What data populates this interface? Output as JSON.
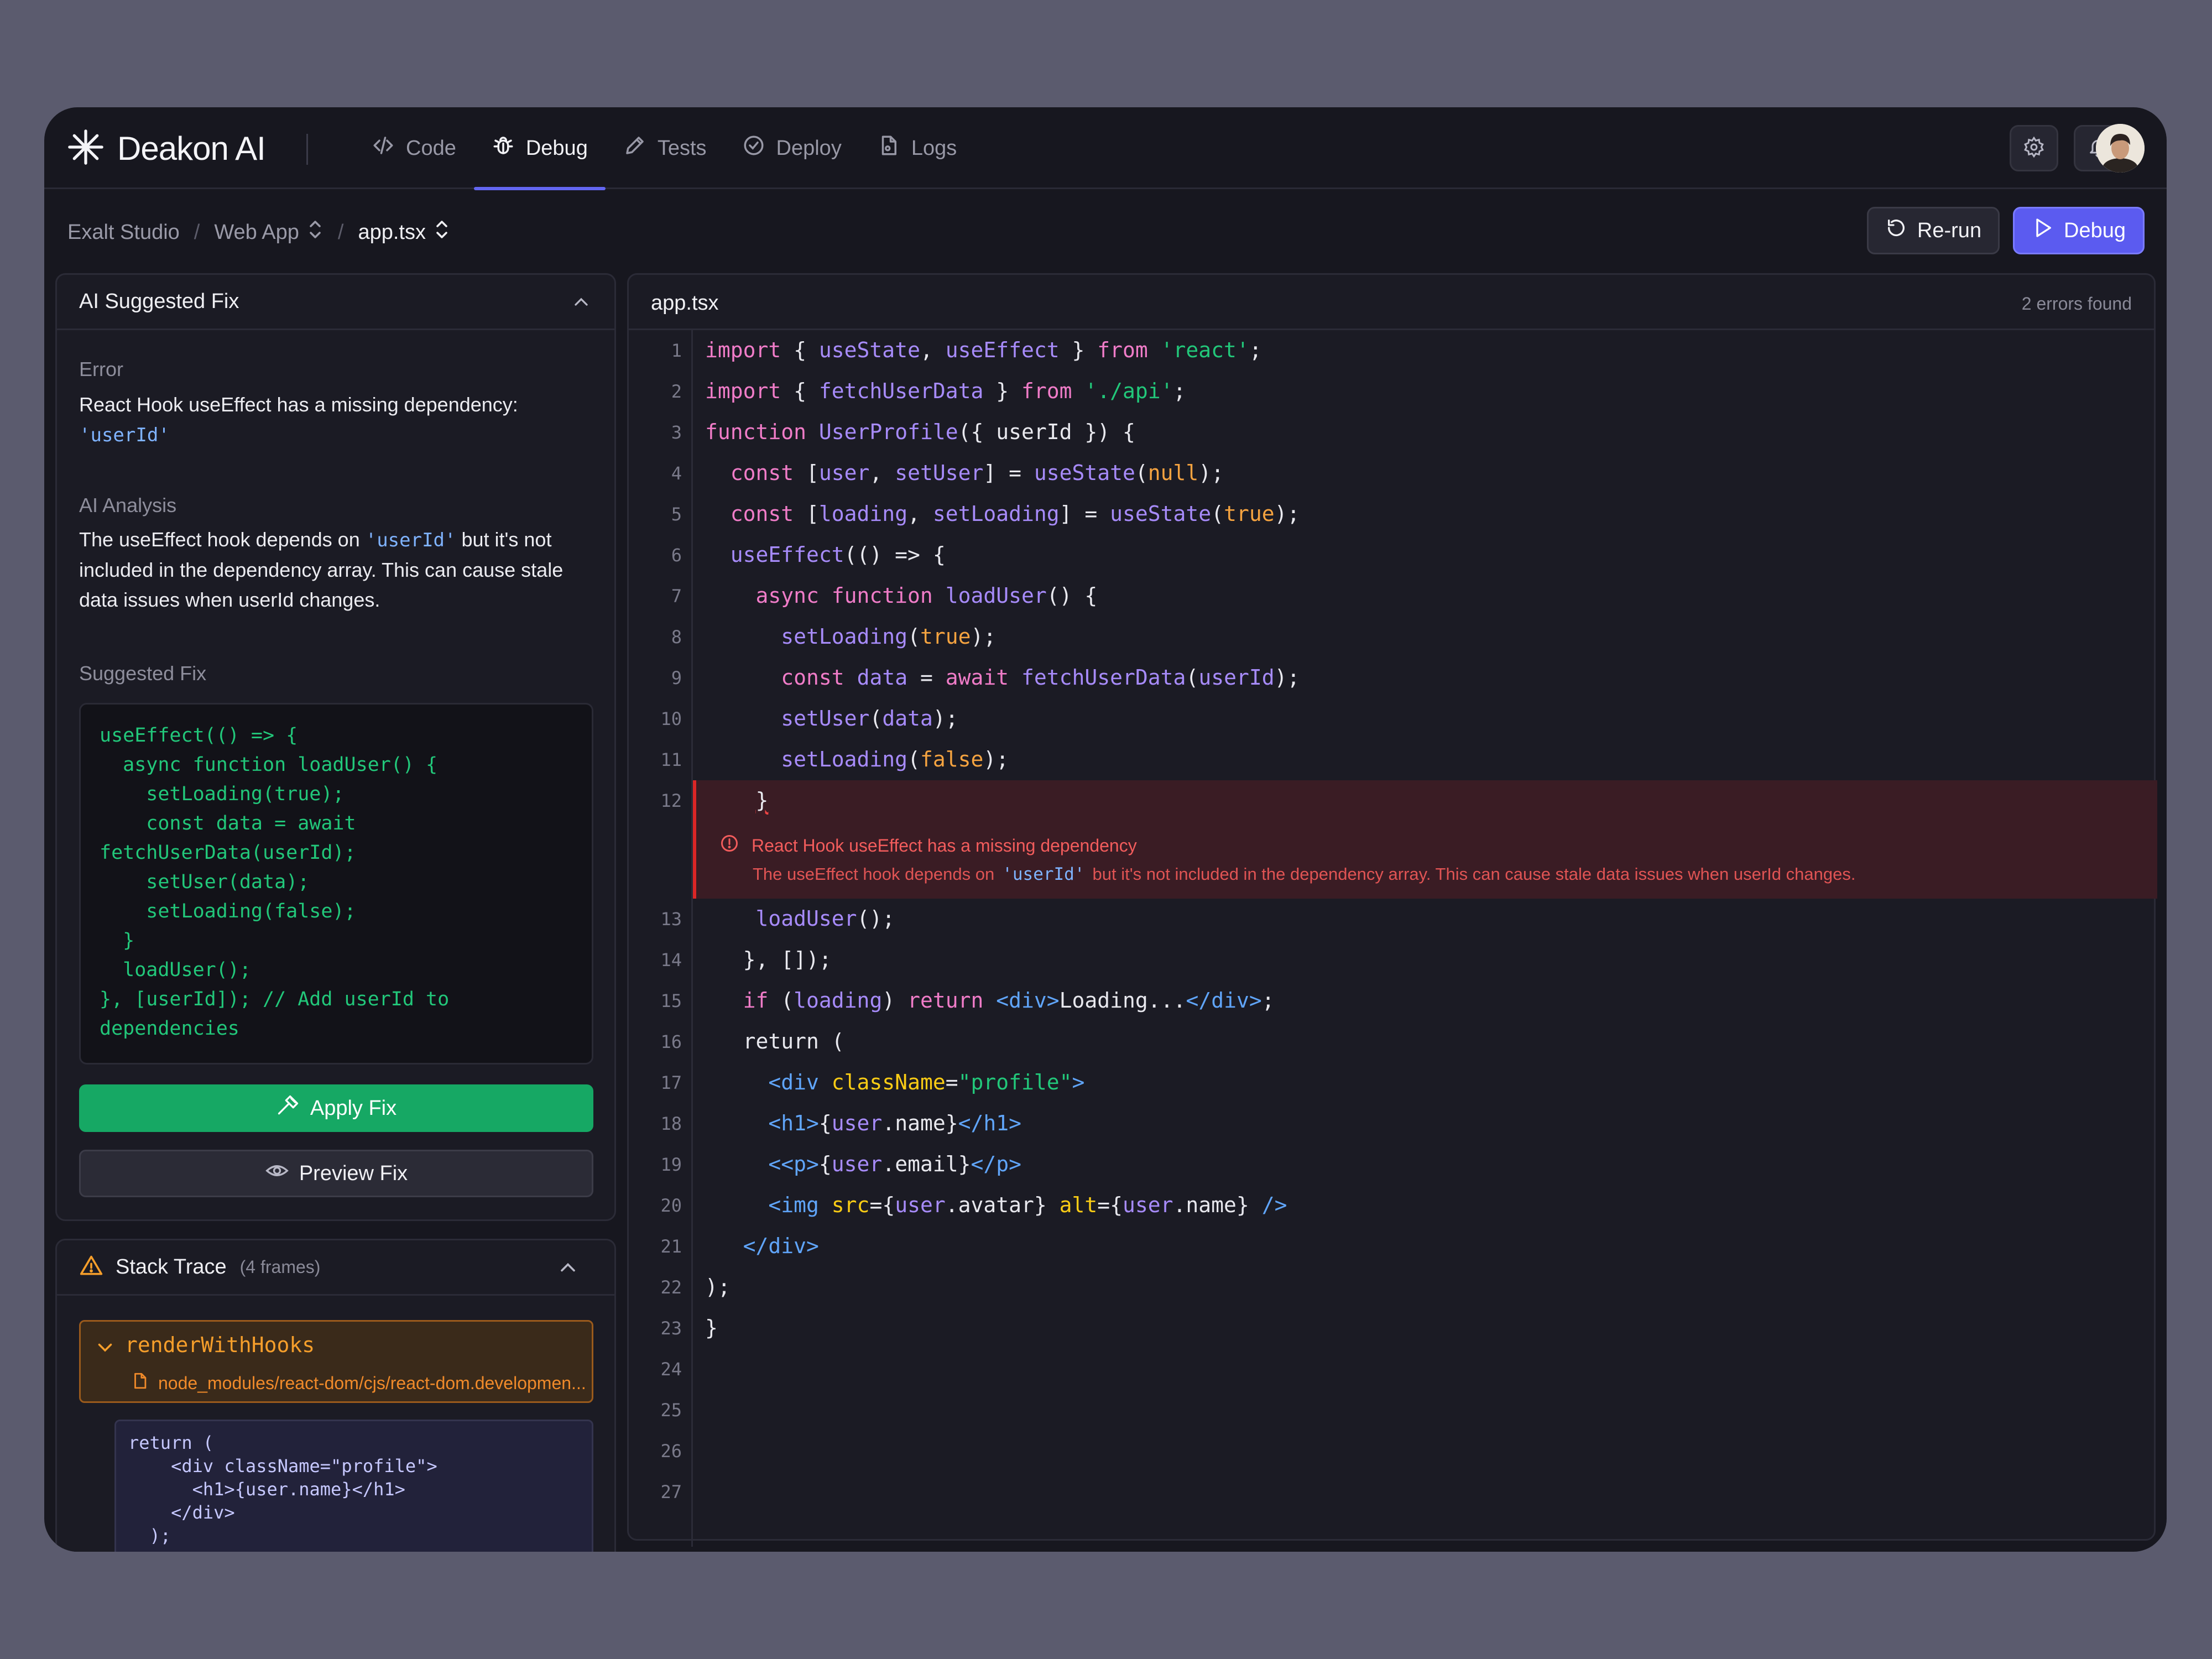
{
  "app": {
    "name": "Deakon AI"
  },
  "nav": {
    "tabs": [
      {
        "label": "Code",
        "icon": "code-icon"
      },
      {
        "label": "Debug",
        "icon": "bug-icon",
        "active": true
      },
      {
        "label": "Tests",
        "icon": "pencil-icon"
      },
      {
        "label": "Deploy",
        "icon": "check-circle-icon"
      },
      {
        "label": "Logs",
        "icon": "file-icon"
      }
    ],
    "icons": [
      "gear-icon",
      "bell-icon",
      "avatar"
    ]
  },
  "breadcrumb": {
    "items": [
      "Exalt Studio",
      "Web App",
      "app.tsx"
    ]
  },
  "actions": {
    "rerun_label": "Re-run",
    "debug_label": "Debug"
  },
  "fix_panel": {
    "title": "AI Suggested Fix",
    "error_label": "Error",
    "error_text": "React Hook useEffect has a missing dependency:",
    "error_code": "'userId'",
    "analysis_label": "AI Analysis",
    "analysis_before": "The useEffect hook depends on ",
    "analysis_code": "'userId'",
    "analysis_after": " but it's not included in the dependency array. This can cause stale data issues when userId changes.",
    "suggested_label": "Suggested Fix",
    "suggested_code": "useEffect(() => {\n  async function loadUser() {\n    setLoading(true);\n    const data = await\nfetchUserData(userId);\n    setUser(data);\n    setLoading(false);\n  }\n  loadUser();\n}, [userId]); // Add userId to\ndependencies",
    "apply_label": "Apply Fix",
    "preview_label": "Preview Fix"
  },
  "stack_trace": {
    "title": "Stack Trace",
    "count": "(4 frames)",
    "frame_fn": "renderWithHooks",
    "frame_file": "node_modules/react-dom/cjs/react-dom.developmen...",
    "snippet": "return (\n    <div className=\"profile\">\n      <h1>{user.name}</h1>\n    </div>\n  );"
  },
  "editor": {
    "filename": "app.tsx",
    "errors_found": "2 errors found",
    "error": {
      "title": "React Hook useEffect has a missing dependency",
      "desc_before": "The useEffect hook depends on",
      "desc_code": "'userId'",
      "desc_after": "but it's not included in the dependency array. This can cause stale data issues when userId changes."
    },
    "lines": [
      "1",
      "2",
      "3",
      "4",
      "5",
      "6",
      "7",
      "8",
      "9",
      "10",
      "11",
      "12",
      "13",
      "14",
      "15",
      "16",
      "17",
      "18",
      "19",
      "20",
      "21",
      "22",
      "23",
      "24",
      "25",
      "26",
      "27"
    ]
  },
  "colors": {
    "accent": "#5b5bf0",
    "success": "#16a864",
    "error": "#dc2626",
    "warning": "#f59e2b"
  }
}
